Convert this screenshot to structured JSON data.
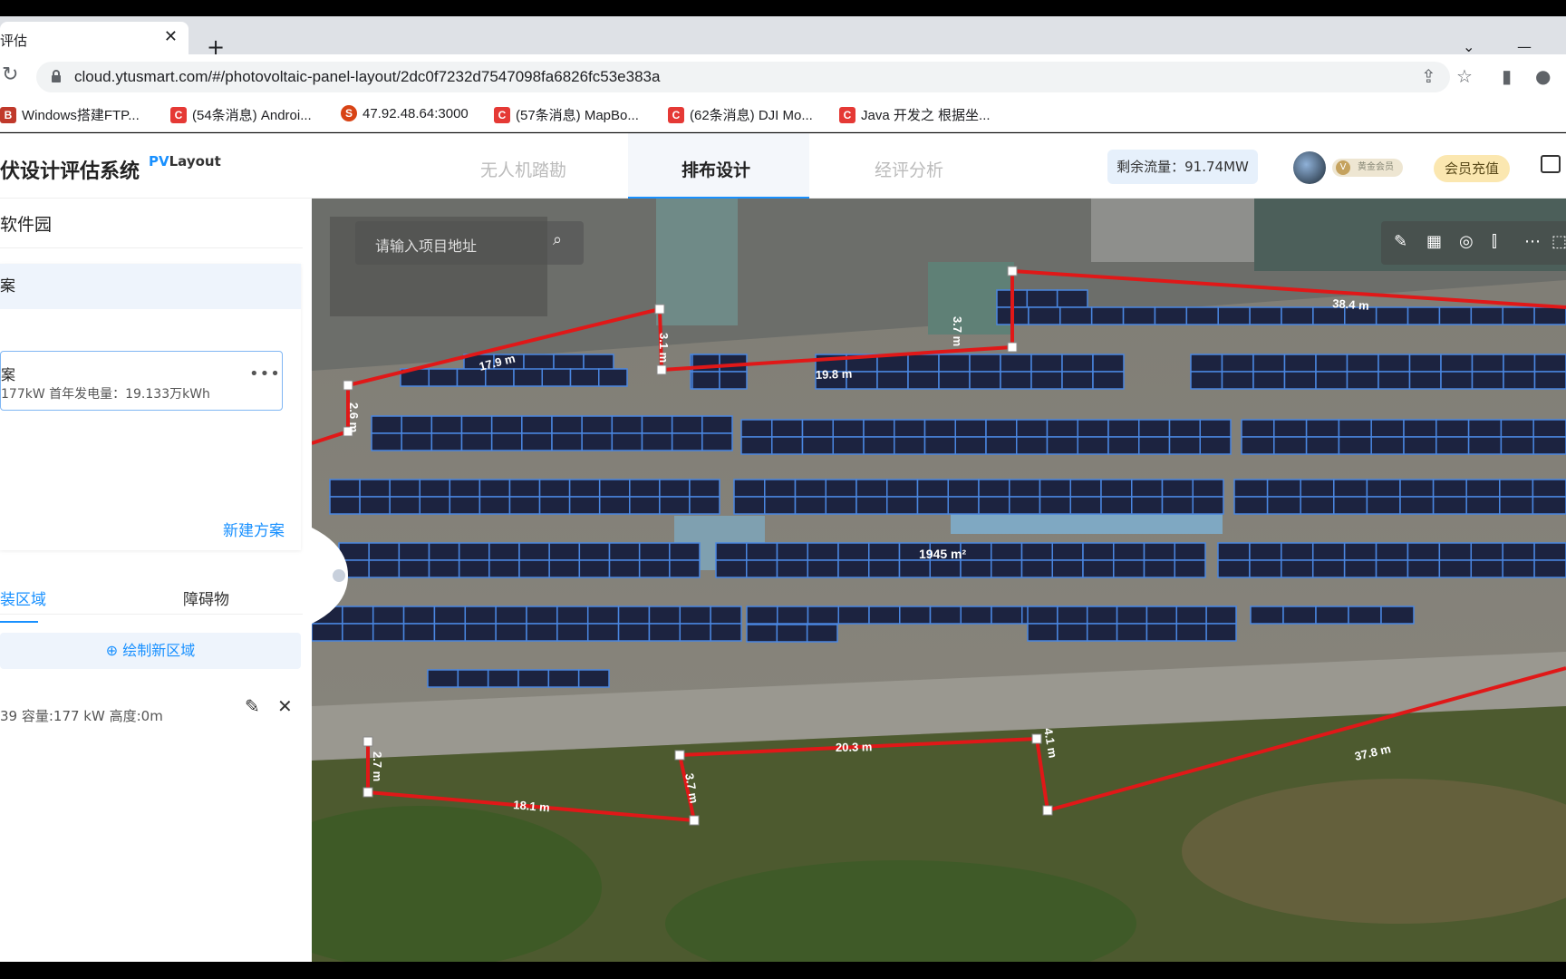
{
  "browser": {
    "tab_title": "评估",
    "tab_close": "✕",
    "new_tab": "+",
    "url": "cloud.ytusmart.com/#/photovoltaic-panel-layout/2dc0f7232d7547098fa6826fc53e383a",
    "bookmarks": [
      {
        "icon": "B",
        "label": "Windows搭建FTP..."
      },
      {
        "icon": "C",
        "label": "(54条消息) Androi..."
      },
      {
        "icon": "S",
        "label": "47.92.48.64:3000"
      },
      {
        "icon": "C",
        "label": "(57条消息) MapBo..."
      },
      {
        "icon": "C",
        "label": "(62条消息) DJI Mo..."
      },
      {
        "icon": "C",
        "label": "Java 开发之 根据坐..."
      }
    ]
  },
  "header": {
    "app_title": "伏设计评估系统",
    "logo_pv": "PV",
    "logo_layout": "Layout",
    "nav": [
      "无人机踏勘",
      "排布设计",
      "经评分析"
    ],
    "flow_label": "剩余流量：91.74MW",
    "vip_label": "黄金会员",
    "charge_label": "会员充值"
  },
  "sidebar": {
    "project_name": "软件园",
    "plan_header": "案",
    "plan": {
      "name": "案",
      "info": "177kW 首年发电量：19.133万kWh",
      "more": "•••"
    },
    "new_plan": "新建方案",
    "tabs": [
      "装区域",
      "障碍物"
    ],
    "draw_button": "⊕ 绘制新区域",
    "area_item": "39 容量:177 kW 高度:0m"
  },
  "map": {
    "search_placeholder": "请输入项目地址",
    "area_label": "1945 m²",
    "measurements": [
      "38.4 m",
      "3.7 m",
      "19.8 m",
      "3.1 m",
      "17.9 m",
      "2.6 m",
      "20.3 m",
      "4.1 m",
      "37.8 m",
      "2.7 m",
      "18.1 m",
      "3.7 m"
    ]
  }
}
